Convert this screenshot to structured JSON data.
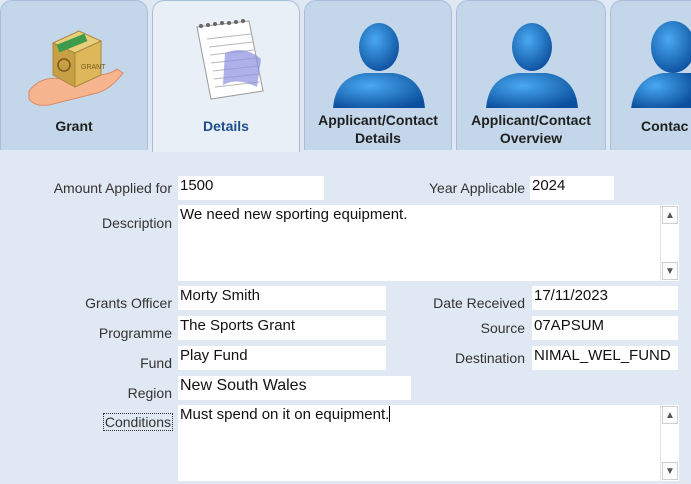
{
  "tabs": [
    {
      "label": "Grant",
      "icon": "grant-hand-box-icon",
      "active": false
    },
    {
      "label": "Details",
      "icon": "notepad-icon",
      "active": true
    },
    {
      "label_line1": "Applicant/Contact",
      "label_line2": "Details",
      "icon": "user-silhouette-icon",
      "active": false
    },
    {
      "label_line1": "Applicant/Contact",
      "label_line2": "Overview",
      "icon": "user-silhouette-icon",
      "active": false
    },
    {
      "label": "Contac",
      "icon": "user-silhouette-icon",
      "active": false
    }
  ],
  "form": {
    "amount_applied_for": {
      "label": "Amount Applied for",
      "value": "1500"
    },
    "year_applicable": {
      "label": "Year Applicable",
      "value": "2024"
    },
    "description": {
      "label": "Description",
      "value": "We need new sporting equipment."
    },
    "grants_officer": {
      "label": "Grants Officer",
      "value": "Morty Smith"
    },
    "date_received": {
      "label": "Date Received",
      "value": "17/11/2023"
    },
    "programme": {
      "label": "Programme",
      "value": "The Sports Grant"
    },
    "source": {
      "label": "Source",
      "value": "07APSUM"
    },
    "fund": {
      "label": "Fund",
      "value": "Play Fund"
    },
    "destination": {
      "label": "Destination",
      "value": "NIMAL_WEL_FUND"
    },
    "region": {
      "label": "Region",
      "value": "New South Wales"
    },
    "conditions": {
      "label": "Conditions",
      "value": "Must spend on it on equipment."
    }
  },
  "scroll_glyphs": {
    "up": "▲",
    "down": "▼"
  }
}
